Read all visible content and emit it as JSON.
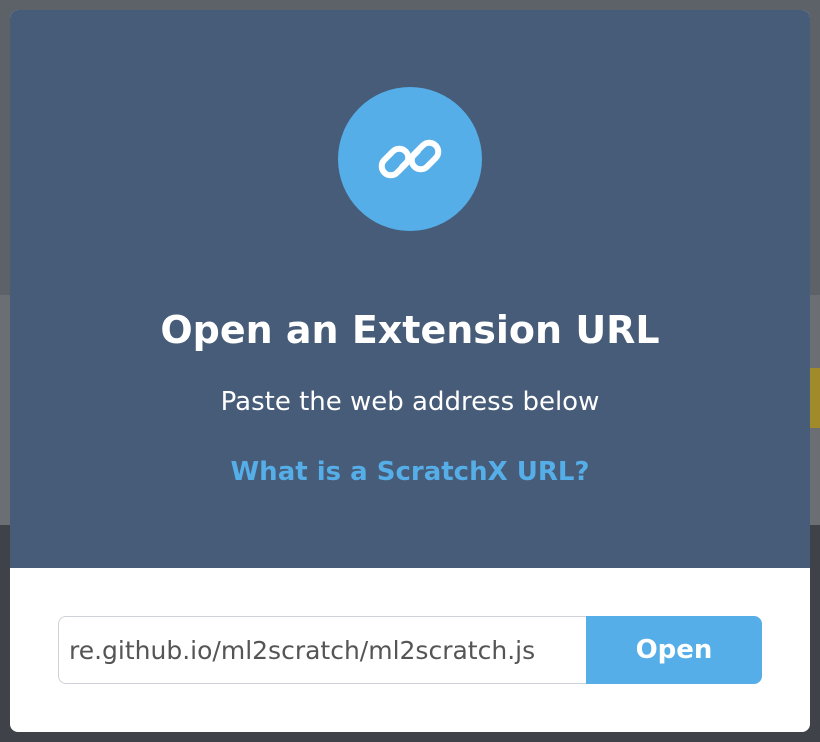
{
  "dialog": {
    "icon": "link-icon",
    "title": "Open an Extension URL",
    "subtitle": "Paste the web address below",
    "help_link": "What is a ScratchX URL?"
  },
  "url_form": {
    "value": "re.github.io/ml2scratch/ml2scratch.js",
    "submit_label": "Open"
  },
  "colors": {
    "header_bg": "#475c78",
    "accent": "#55aee8",
    "panel_bg": "#ffffff"
  }
}
